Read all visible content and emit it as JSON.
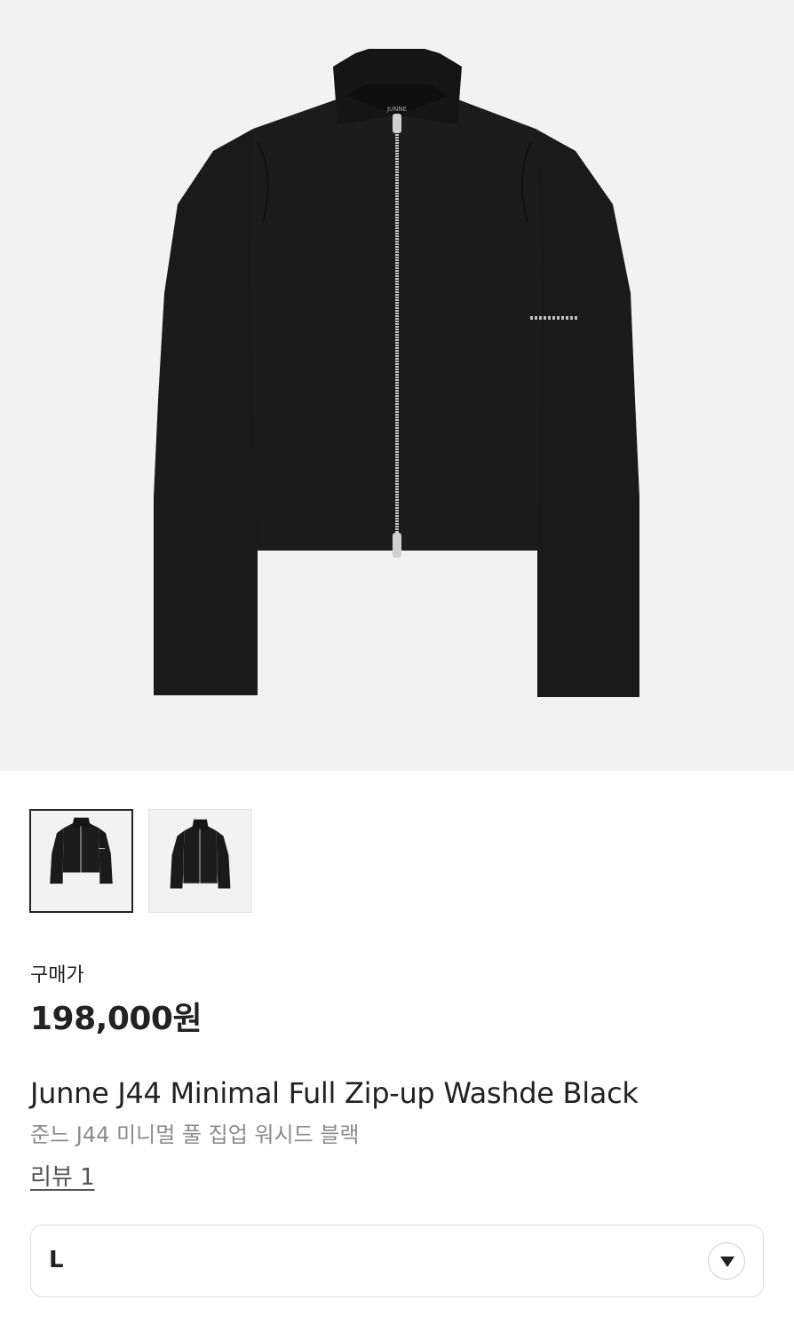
{
  "product": {
    "price_label": "구매가",
    "price": "198,000원",
    "name_en": "Junne J44 Minimal Full Zip-up Washde Black",
    "name_ko": "준느 J44 미니멀 풀 집업 워시드 블랙",
    "review_link": "리뷰 1"
  },
  "gallery": {
    "brand_tag": "JUNNE",
    "thumbnails": [
      {
        "selected": true
      },
      {
        "selected": false
      }
    ]
  },
  "size_select": {
    "selected_value": "L",
    "icon": "caret-down-icon"
  },
  "colors": {
    "garment": "#1a1a1a",
    "background": "#f2f2f2",
    "zipper": "#c8c8c8"
  }
}
